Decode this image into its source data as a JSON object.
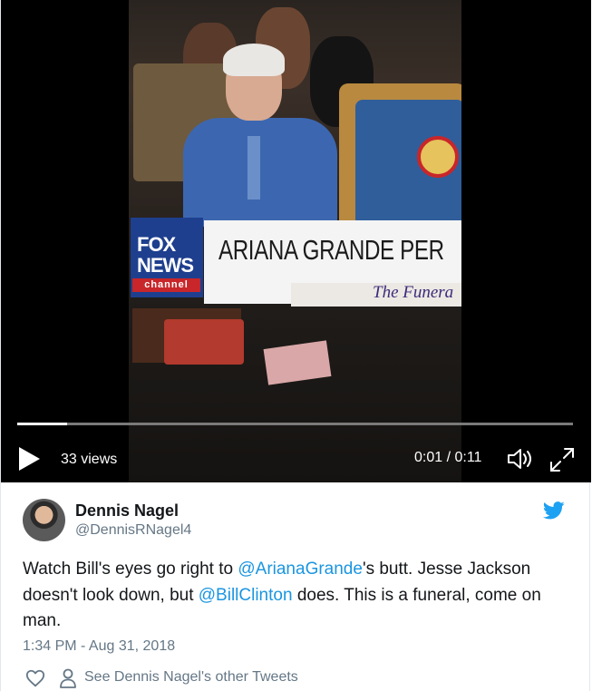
{
  "video": {
    "banner_text": "ARIANA GRANDE PER",
    "banner_subtext": "The Funera",
    "network_logo": {
      "line1": "FOX",
      "line2": "NEWS",
      "line3": "channel"
    },
    "progress_fraction": 0.09,
    "views_label": "33 views",
    "time_label": "0:01 / 0:11",
    "icons": {
      "play": "play-icon",
      "volume": "volume-icon",
      "fullscreen": "fullscreen-icon"
    }
  },
  "tweet": {
    "display_name": "Dennis Nagel",
    "handle": "@DennisRNagel4",
    "text_parts": [
      "Watch Bill's eyes go right to ",
      "@ArianaGrande",
      "'s butt. Jesse Jackson doesn't look down, but ",
      "@BillClinton",
      " does. This is a funeral, come on man."
    ],
    "timestamp": "1:34 PM - Aug 31, 2018",
    "other_tweets_link": "See Dennis Nagel's other Tweets",
    "icons": {
      "brand": "twitter-bird-icon",
      "like": "heart-icon",
      "profile": "person-icon"
    }
  },
  "colors": {
    "link": "#1b95e0",
    "secondary_text": "#657786",
    "brand": "#1da1f2"
  }
}
